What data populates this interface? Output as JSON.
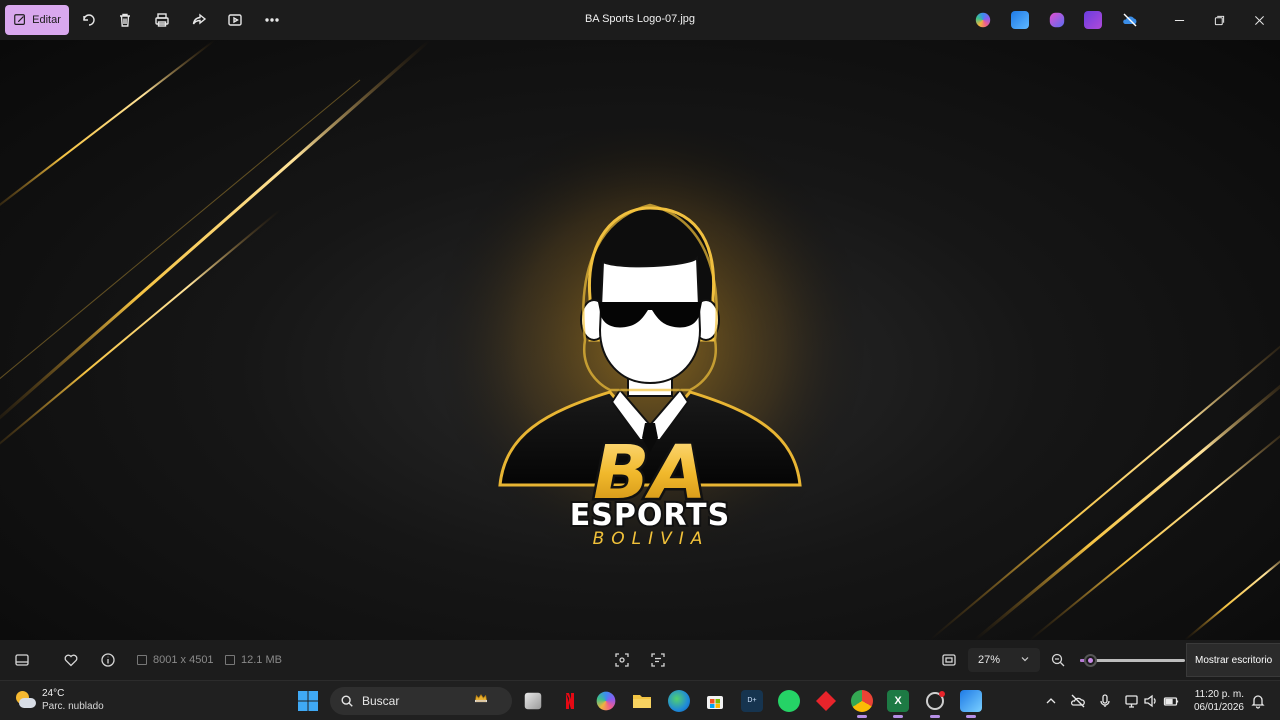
{
  "window": {
    "title": "BA Sports Logo-07.jpg",
    "edit_label": "Editar"
  },
  "logo": {
    "initials": "BA",
    "line1": "ESPORTS",
    "line2": "BOLIVIA"
  },
  "colors": {
    "accent": "#d9a8ee",
    "gold": "#f2c23a",
    "titlebar": "#1c1c1c",
    "taskbar": "#202020"
  },
  "image_info": {
    "dimensions": "8001 x 4501",
    "file_size": "12.1 MB"
  },
  "zoom": {
    "value": "27%",
    "slider_level": 0.08
  },
  "tooltip": "Mostrar escritorio",
  "taskbar": {
    "weather_temp": "24°C",
    "weather_desc": "Parc. nublado",
    "search_placeholder": "Buscar",
    "time": "11:20 p. m.",
    "date": "06/01/2026"
  }
}
